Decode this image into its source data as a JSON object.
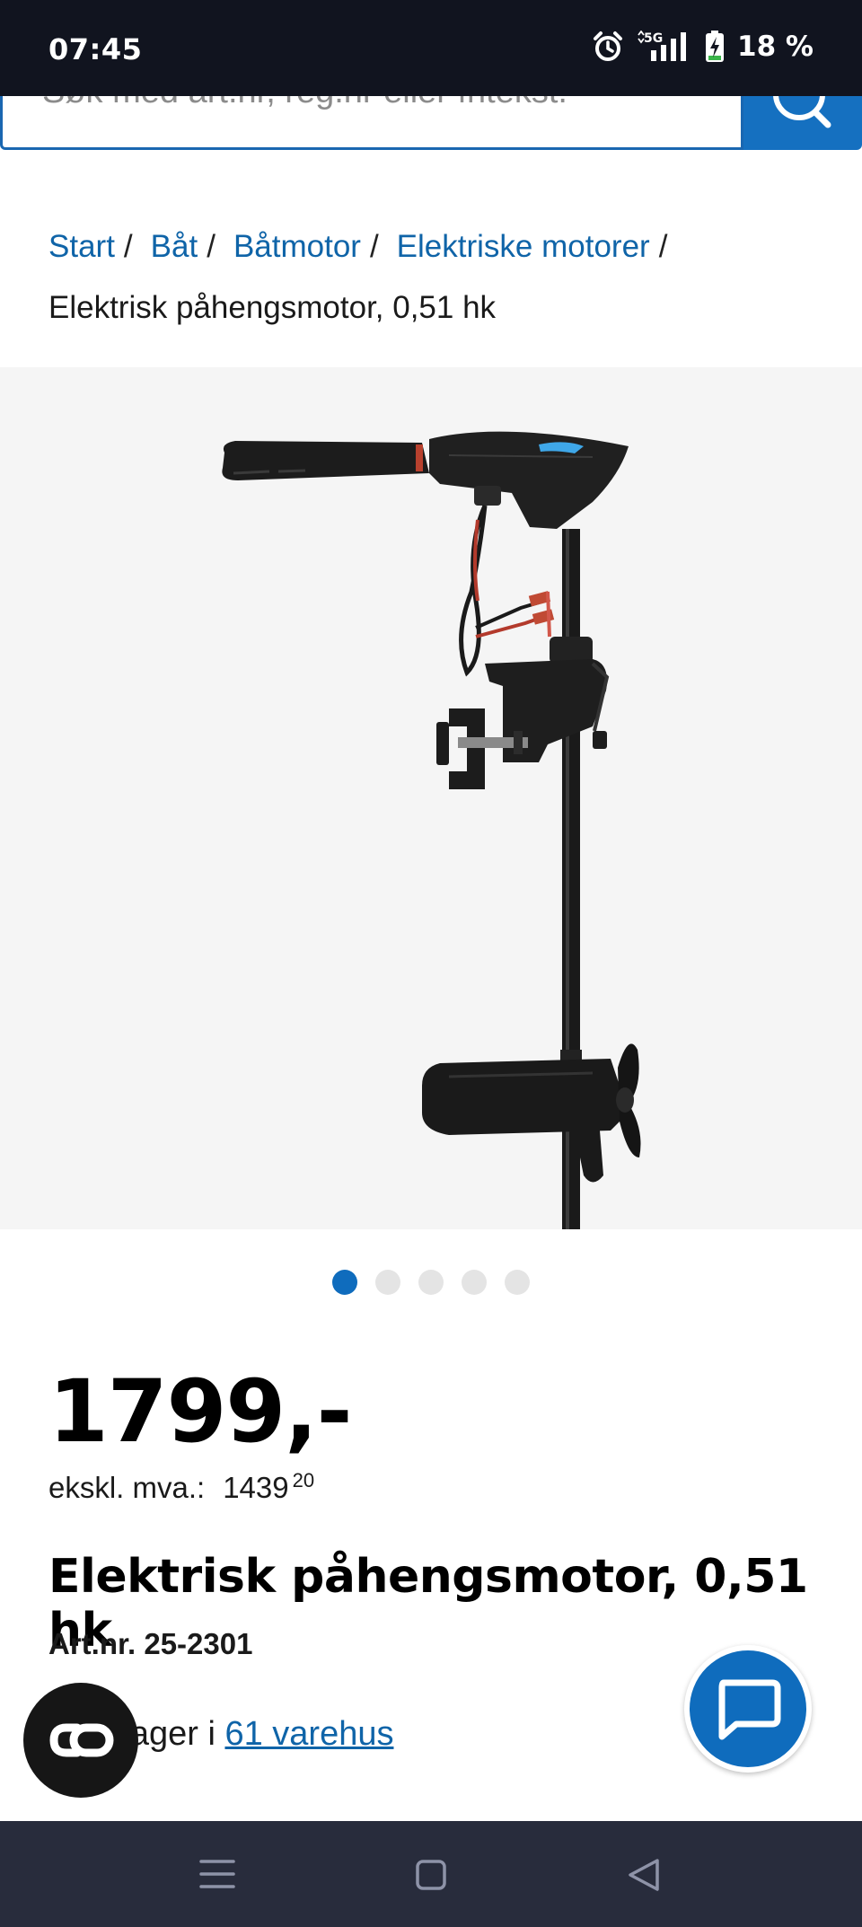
{
  "status_bar": {
    "time": "07:45",
    "network": "5G",
    "battery": "18 %",
    "icons": [
      "alarm-icon",
      "signal-icon",
      "battery-charging-icon"
    ]
  },
  "search": {
    "placeholder": "Søk med art.nr, reg.nr eller fritekst.",
    "button_icon": "search-icon"
  },
  "breadcrumb": {
    "items": [
      "Start",
      "Båt",
      "Båtmotor",
      "Elektriske motorer"
    ],
    "separator": "/",
    "current": "Elektrisk påhengsmotor, 0,51 hk"
  },
  "gallery": {
    "image_count": 5,
    "active_index": 0
  },
  "product": {
    "price": "1799,-",
    "ex_vat_label": "ekskl. mva.:",
    "ex_vat_amount": "1439",
    "ex_vat_cents": "20",
    "title": "Elektrisk påhengsmotor, 0,51 hk",
    "art_nr": "Art.nr. 25-2301",
    "stock_text": "s på lager i ",
    "stock_link": "61 varehus"
  },
  "floating": {
    "left_icon": "co-link-icon",
    "right_icon": "chat-icon"
  },
  "nav_bar": {
    "icons": [
      "menu-icon",
      "home-icon",
      "back-icon"
    ]
  },
  "colors": {
    "brand_blue": "#0f64a8",
    "status_bg": "#11141f",
    "nav_bg": "#282c3c"
  }
}
